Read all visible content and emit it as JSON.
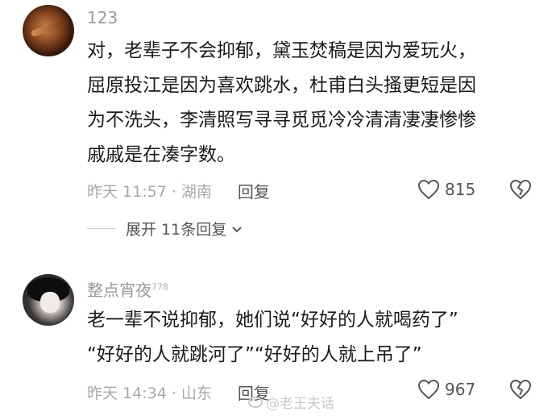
{
  "comments": [
    {
      "username": "123",
      "text": "对，老辈子不会抑郁，黛玉焚稿是因为爱玩火，\n屈原投江是因为喜欢跳水，杜甫白头搔更短是因\n为不洗头，李清照写寻寻觅觅冷冷清清凄凄惨惨\n戚戚是在凑字数。",
      "time_location": "昨天 11:57 · 湖南",
      "reply_label": "回复",
      "likes": "815",
      "expand_label": "展开 11条回复"
    },
    {
      "username": "整点宵夜",
      "username_sup": "778",
      "text": "老一辈不说抑郁，她们说“好好的人就喝药了”\n“好好的人就跳河了”“好好的人就上吊了”",
      "time_location": "昨天 14:34 · 山东",
      "reply_label": "回复",
      "likes": "967"
    }
  ],
  "watermark": "@老王夫话"
}
